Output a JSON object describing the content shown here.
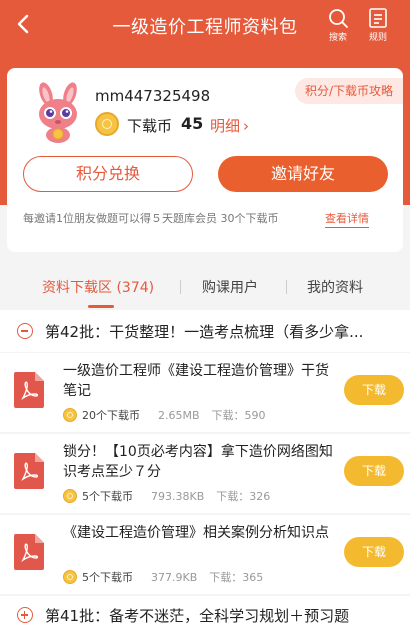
{
  "header": {
    "title": "一级造价工程师资料包",
    "search_label": "搜索",
    "rules_label": "规则"
  },
  "profile": {
    "username": "mm447325498",
    "coin_label": "下载币",
    "coin_value": "45",
    "detail_link": "明细",
    "points_tag": "积分/下载币攻略",
    "exchange_button": "积分兑换",
    "invite_button": "邀请好友",
    "invite_note": "每邀请1位朋友做题可以得５天题库会员 30个下载币",
    "view_detail": "查看详情"
  },
  "tabs": [
    {
      "label": "资料下载区 (374)",
      "active": true
    },
    {
      "label": "购课用户",
      "active": false
    },
    {
      "label": "我的资料",
      "active": false
    }
  ],
  "sections": [
    {
      "title": "第42批：干货整理！一造考点梳理（看多少拿...",
      "expanded": true
    },
    {
      "title": "第41批：备考不迷茫，全科学习规划＋预习题",
      "expanded": false
    }
  ],
  "items": [
    {
      "title": "一级造价工程师《建设工程造价管理》干货笔记",
      "price": "20个下载币",
      "size": "2.65MB",
      "downloads": "下载：590",
      "button": "下载"
    },
    {
      "title": "锁分！【10页必考内容】拿下造价网络图知识考点至少７分",
      "price": "5个下载币",
      "size": "793.38KB",
      "downloads": "下载：326",
      "button": "下载"
    },
    {
      "title": "《建设工程造价管理》相关案例分析知识点",
      "price": "5个下载币",
      "size": "377.9KB",
      "downloads": "下载：365",
      "button": "下载"
    }
  ],
  "colors": {
    "accent": "#e65a3c",
    "download_button": "#f3ba2f",
    "coin": "#f6c343"
  },
  "icons": [
    "back-arrow-icon",
    "search-icon",
    "rules-icon",
    "coin-icon",
    "pdf-icon",
    "collapse-icon",
    "expand-icon"
  ]
}
